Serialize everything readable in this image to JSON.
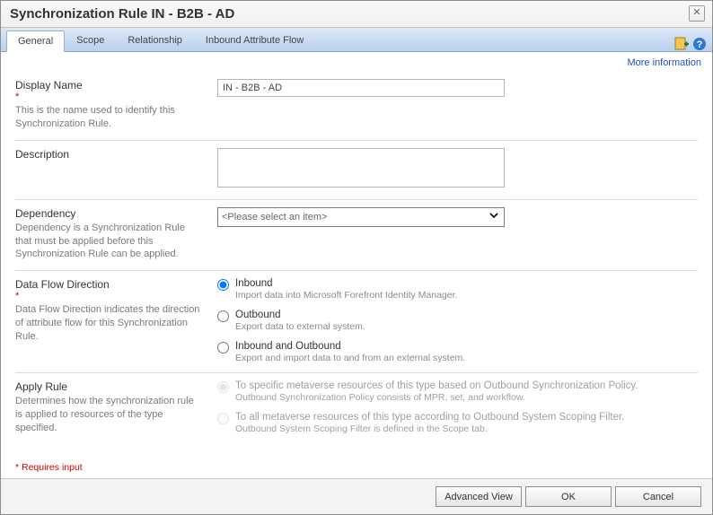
{
  "header": {
    "title": "Synchronization Rule IN - B2B - AD"
  },
  "tabs": {
    "items": [
      {
        "label": "General"
      },
      {
        "label": "Scope"
      },
      {
        "label": "Relationship"
      },
      {
        "label": "Inbound Attribute Flow"
      }
    ],
    "activeIndex": 0
  },
  "links": {
    "more": "More information"
  },
  "form": {
    "displayName": {
      "label": "Display Name",
      "desc": "This is the name used to identify this Synchronization Rule.",
      "value": "IN - B2B - AD"
    },
    "description": {
      "label": "Description",
      "value": ""
    },
    "dependency": {
      "label": "Dependency",
      "desc": "Dependency is a Synchronization Rule that must be applied before this Synchronization Rule can be applied.",
      "placeholder": "<Please select an item>"
    },
    "flow": {
      "label": "Data Flow Direction",
      "desc": "Data Flow Direction indicates the direction of attribute flow for this Synchronization Rule.",
      "options": [
        {
          "label": "Inbound",
          "sub": "Import data into Microsoft Forefront Identity Manager."
        },
        {
          "label": "Outbound",
          "sub": "Export data to external system."
        },
        {
          "label": "Inbound and Outbound",
          "sub": "Export and import data to and from an external system."
        }
      ],
      "selected": 0
    },
    "apply": {
      "label": "Apply Rule",
      "desc": "Determines how the synchronization rule is applied to resources of the type specified.",
      "options": [
        {
          "label": "To specific metaverse resources of this type based on Outbound Synchronization Policy.",
          "sub": "Outbound Synchronization Policy consists of MPR, set, and workflow."
        },
        {
          "label": "To all metaverse resources of this type according to Outbound System Scoping Filter.",
          "sub": "Outbound System Scoping Filter is defined in the Scope tab."
        }
      ],
      "selected": 0
    }
  },
  "notes": {
    "required": "* Requires input"
  },
  "footer": {
    "advanced": "Advanced View",
    "ok": "OK",
    "cancel": "Cancel"
  }
}
